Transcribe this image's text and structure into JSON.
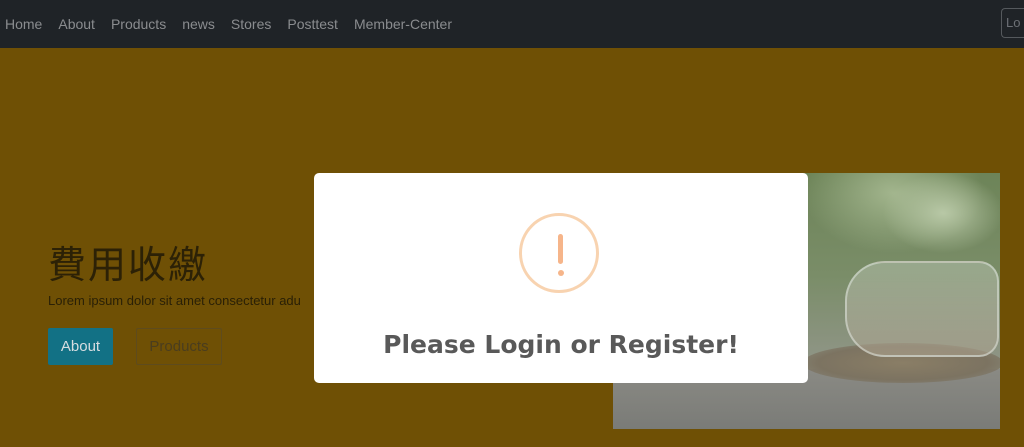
{
  "nav": {
    "items": [
      "Home",
      "About",
      "Products",
      "news",
      "Stores",
      "Posttest",
      "Member-Center"
    ],
    "login_partial": "Lo"
  },
  "hero": {
    "title": "費用收繳",
    "text": "Lorem ipsum dolor sit amet consectetur adu",
    "about_button": "About",
    "products_button": "Products"
  },
  "modal": {
    "icon": "exclamation-icon",
    "title": "Please Login or Register!"
  },
  "colors": {
    "navbar": "#1f2327",
    "hero_background": "#6f5005",
    "about_button": "#127185",
    "alert_ring": "#f8d3b0"
  }
}
